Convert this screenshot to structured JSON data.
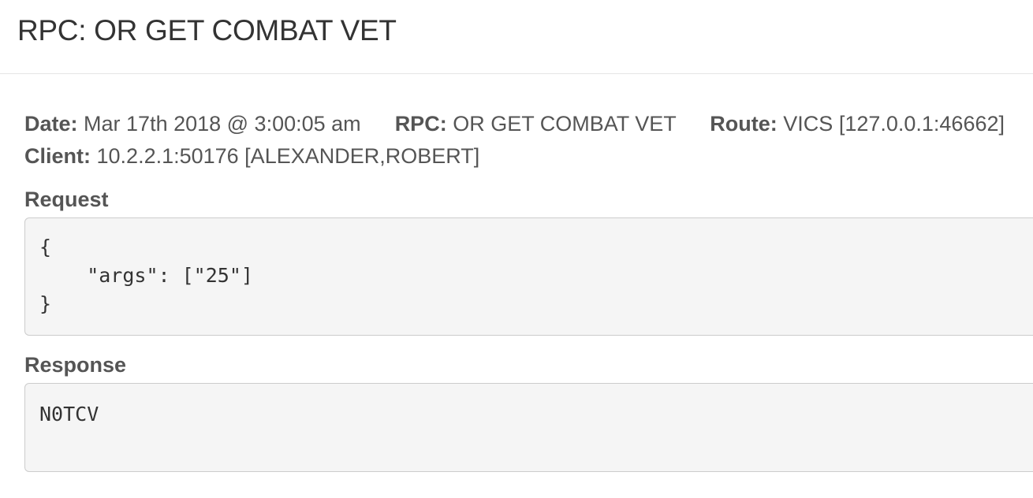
{
  "page": {
    "title": "RPC: OR GET COMBAT VET"
  },
  "meta": {
    "date_label": "Date:",
    "date_value": "Mar 17th 2018 @ 3:00:05 am",
    "rpc_label": "RPC:",
    "rpc_value": "OR GET COMBAT VET",
    "route_label": "Route:",
    "route_value": "VICS [127.0.0.1:46662]",
    "client_label": "Client:",
    "client_value": "10.2.2.1:50176 [ALEXANDER,ROBERT]"
  },
  "request": {
    "label": "Request",
    "body": "{\n    \"args\": [\"25\"]\n}"
  },
  "response": {
    "label": "Response",
    "body": "N0TCV"
  }
}
